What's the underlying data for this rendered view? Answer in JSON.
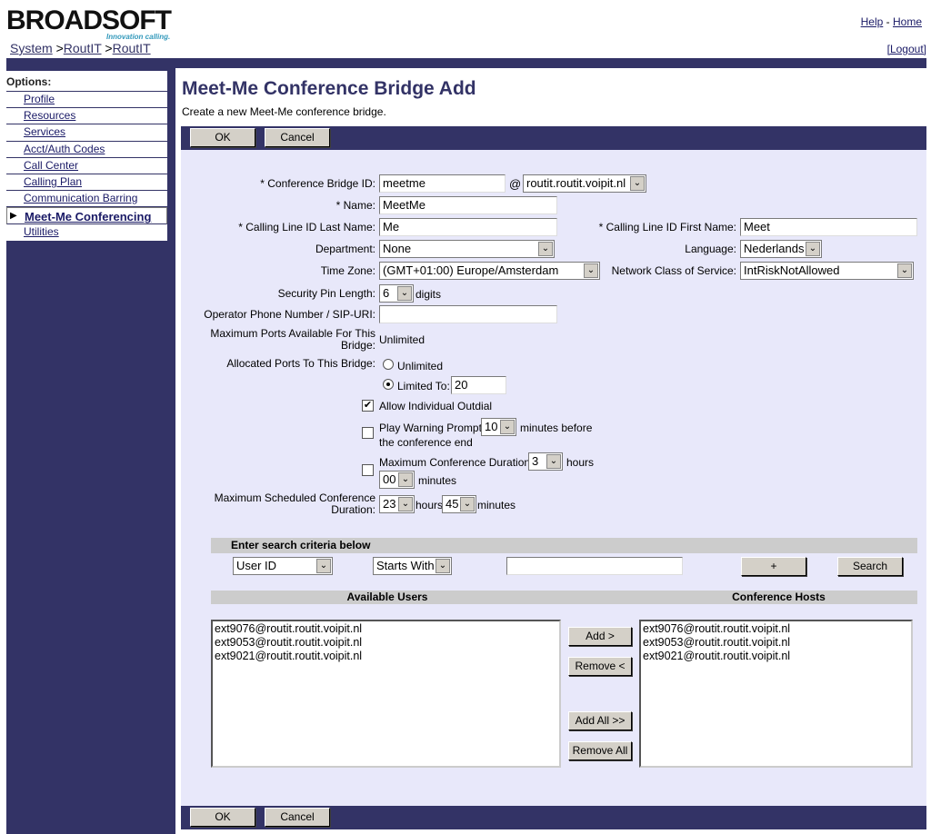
{
  "header": {
    "logo": "BROADSOFT",
    "tagline": "Innovation calling.",
    "help": "Help",
    "home": "Home",
    "logout": "[Logout]",
    "crumbs": [
      "System",
      "RoutIT",
      "RoutIT"
    ],
    "sep": " >"
  },
  "sidebar": {
    "title": "Options:",
    "items": [
      {
        "label": "Profile"
      },
      {
        "label": "Resources"
      },
      {
        "label": "Services"
      },
      {
        "label": "Acct/Auth Codes"
      },
      {
        "label": "Call Center"
      },
      {
        "label": "Calling Plan"
      },
      {
        "label": "Communication Barring"
      },
      {
        "label": "Meet-Me Conferencing",
        "selected": true
      },
      {
        "label": "Utilities"
      }
    ]
  },
  "page": {
    "title": "Meet-Me Conference Bridge Add",
    "description": "Create a new Meet-Me conference bridge.",
    "ok": "OK",
    "cancel": "Cancel"
  },
  "form": {
    "bridge_id_label": "* Conference Bridge ID:",
    "bridge_id": "meetme",
    "at": "@",
    "domain": "routit.routit.voipit.nl",
    "name_label": "* Name:",
    "name": "MeetMe",
    "last_label": "* Calling Line ID Last Name:",
    "last": "Me",
    "first_label": "* Calling Line ID First Name:",
    "first": "Meet",
    "dept_label": "Department:",
    "dept": "None",
    "lang_label": "Language:",
    "lang": "Nederlands",
    "tz_label": "Time Zone:",
    "tz": "(GMT+01:00) Europe/Amsterdam",
    "ncos_label": "Network Class of Service:",
    "ncos": "IntRiskNotAllowed",
    "pin_label": "Security Pin Length:",
    "pin": "6",
    "digits": "digits",
    "operator_label": "Operator Phone Number / SIP-URI:",
    "operator": "",
    "maxports_label1": "Maximum Ports Available For This",
    "maxports_label2": "Bridge:",
    "maxports": "Unlimited",
    "alloc_label": "Allocated Ports To This Bridge:",
    "alloc_unlimited": "Unlimited",
    "alloc_limited": "Limited To:",
    "alloc_value": "20",
    "alloc_selected": "limited",
    "outdial": "Allow Individual Outdial",
    "outdial_checked": true,
    "warn1": "Play Warning Prompt",
    "warn_value": "10",
    "warn2": "minutes before",
    "warn3": "the conference end",
    "warn_checked": false,
    "maxdur1": "Maximum Conference Duration",
    "maxdur_hours": "3",
    "hours": "hours",
    "maxdur_minutes": "00",
    "minutes": "minutes",
    "maxdur_checked": false,
    "sched_label1": "Maximum Scheduled Conference",
    "sched_label2": "Duration:",
    "sched_hours": "23",
    "sched_minutes": "45"
  },
  "search": {
    "header": "Enter search criteria below",
    "field": "User ID",
    "mode": "Starts With",
    "value": "",
    "plus": "+",
    "search": "Search"
  },
  "users": {
    "available_header": "Available Users",
    "hosts_header": "Conference Hosts",
    "available": [
      "ext9076@routit.routit.voipit.nl",
      "ext9053@routit.routit.voipit.nl",
      "ext9021@routit.routit.voipit.nl"
    ],
    "hosts": [
      "ext9076@routit.routit.voipit.nl",
      "ext9053@routit.routit.voipit.nl",
      "ext9021@routit.routit.voipit.nl"
    ],
    "add": "Add >",
    "remove": "Remove <",
    "add_all": "Add All >>",
    "remove_all": "Remove All"
  }
}
